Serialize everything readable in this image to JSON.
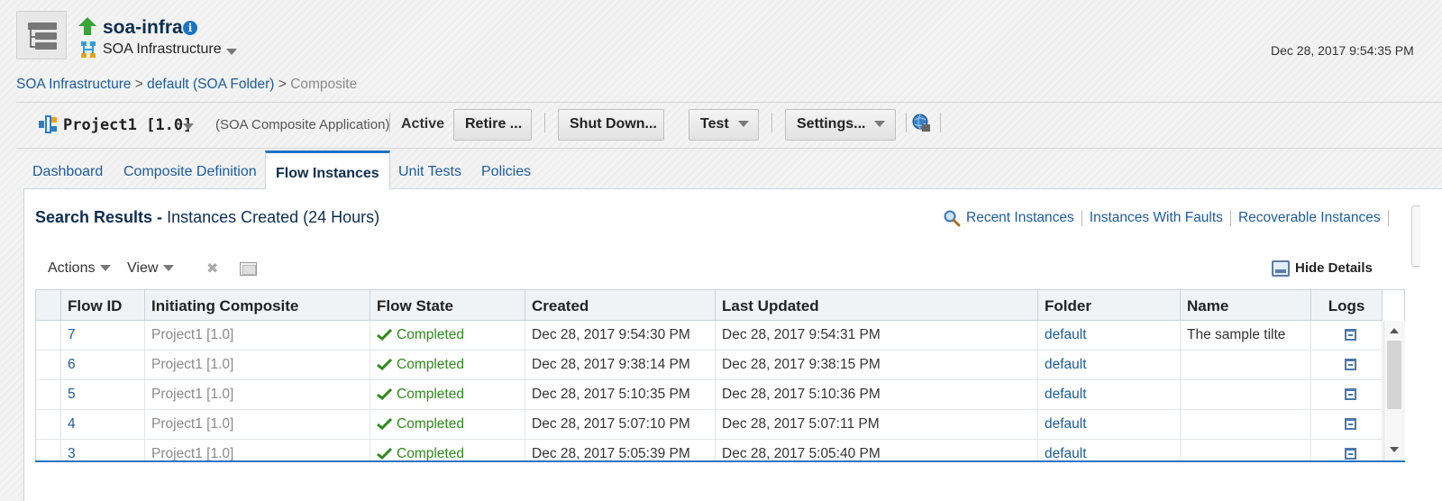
{
  "header": {
    "title": "soa-infra",
    "subtitle": "SOA Infrastructure",
    "timestamp": "Dec 28, 2017 9:54:35 PM"
  },
  "breadcrumb": {
    "item1": "SOA Infrastructure",
    "sep": " > ",
    "item2": "default (SOA Folder)",
    "current": "Composite"
  },
  "composite": {
    "name": "Project1 [1.0]",
    "type": "(SOA Composite Application)",
    "status": "Active",
    "buttons": {
      "retire": "Retire ...",
      "shutdown": "Shut Down...",
      "test": "Test",
      "settings": "Settings..."
    }
  },
  "tabs": [
    "Dashboard",
    "Composite Definition",
    "Flow Instances",
    "Unit Tests",
    "Policies"
  ],
  "search": {
    "label": "Search Results - ",
    "detail": "Instances Created (24 Hours)",
    "links": [
      "Recent Instances",
      "Instances With Faults",
      "Recoverable Instances"
    ]
  },
  "toolbar": {
    "actions": "Actions",
    "view": "View",
    "hide_details": "Hide Details"
  },
  "table": {
    "columns": [
      "Flow ID",
      "Initiating Composite",
      "Flow State",
      "Created",
      "Last Updated",
      "Folder",
      "Name",
      "Logs"
    ],
    "rows": [
      {
        "id": "7",
        "composite": "Project1 [1.0]",
        "state": "Completed",
        "created": "Dec 28, 2017 9:54:30 PM",
        "updated": "Dec 28, 2017 9:54:31 PM",
        "folder": "default",
        "name": "The sample tilte"
      },
      {
        "id": "6",
        "composite": "Project1 [1.0]",
        "state": "Completed",
        "created": "Dec 28, 2017 9:38:14 PM",
        "updated": "Dec 28, 2017 9:38:15 PM",
        "folder": "default",
        "name": ""
      },
      {
        "id": "5",
        "composite": "Project1 [1.0]",
        "state": "Completed",
        "created": "Dec 28, 2017 5:10:35 PM",
        "updated": "Dec 28, 2017 5:10:36 PM",
        "folder": "default",
        "name": ""
      },
      {
        "id": "4",
        "composite": "Project1 [1.0]",
        "state": "Completed",
        "created": "Dec 28, 2017 5:07:10 PM",
        "updated": "Dec 28, 2017 5:07:11 PM",
        "folder": "default",
        "name": ""
      },
      {
        "id": "3",
        "composite": "Project1 [1.0]",
        "state": "Completed",
        "created": "Dec 28, 2017 5:05:39 PM",
        "updated": "Dec 28, 2017 5:05:40 PM",
        "folder": "default",
        "name": ""
      }
    ]
  },
  "colors": {
    "link": "#1d5c9c",
    "accent": "#1b74c3",
    "success": "#2e8a1d",
    "title": "#0d2d4f"
  }
}
